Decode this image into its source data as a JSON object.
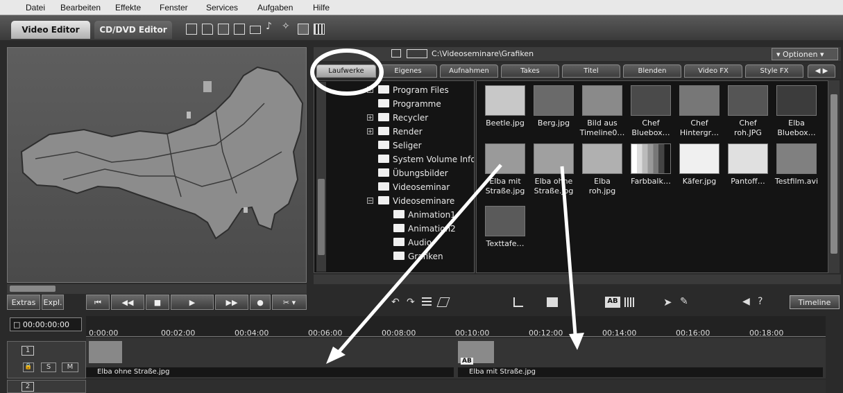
{
  "menu": [
    "Datei",
    "Bearbeiten",
    "Effekte",
    "Fenster",
    "Services",
    "Aufgaben",
    "Hilfe"
  ],
  "main_tabs": {
    "video": "Video Editor",
    "cd": "CD/DVD Editor"
  },
  "browser": {
    "path": "C:\\Videoseminare\\Grafiken",
    "options": "Optionen"
  },
  "sub_tabs": [
    "Laufwerke",
    "Eigenes",
    "Aufnahmen",
    "Takes",
    "Titel",
    "Blenden",
    "Video FX",
    "Style FX"
  ],
  "tree": [
    "Program Files",
    "Programme",
    "Recycler",
    "Render",
    "Seliger",
    "System Volume Infor",
    "Übungsbilder",
    "Videoseminar",
    "Videoseminare",
    "Animation1",
    "Animation2",
    "Audio",
    "Grafiken"
  ],
  "files": [
    {
      "name1": "Beetle.jpg",
      "name2": "",
      "color": "#c8c8c8"
    },
    {
      "name1": "Berg.jpg",
      "name2": "",
      "color": "#6a6a6a"
    },
    {
      "name1": "Bild aus",
      "name2": "Timeline0…",
      "color": "#8a8a8a"
    },
    {
      "name1": "Chef",
      "name2": "Bluebox…",
      "color": "#4a4a4a"
    },
    {
      "name1": "Chef",
      "name2": "Hintergr…",
      "color": "#777777"
    },
    {
      "name1": "Chef",
      "name2": "roh.JPG",
      "color": "#555555"
    },
    {
      "name1": "Elba",
      "name2": "Bluebox…",
      "color": "#3c3c3c"
    },
    {
      "name1": "Elba mit",
      "name2": "Straße.jpg",
      "color": "#9a9a9a"
    },
    {
      "name1": "Elba ohne",
      "name2": "Straße.jpg",
      "color": "#a0a0a0"
    },
    {
      "name1": "Elba",
      "name2": "roh.jpg",
      "color": "#b0b0b0"
    },
    {
      "name1": "Farbbalk…",
      "name2": "",
      "color": "#dddddd"
    },
    {
      "name1": "Käfer.jpg",
      "name2": "",
      "color": "#f0f0f0"
    },
    {
      "name1": "Pantoff…",
      "name2": "",
      "color": "#e0e0e0"
    },
    {
      "name1": "Testfilm.avi",
      "name2": "",
      "color": "#808080"
    },
    {
      "name1": "Texttafe…",
      "name2": "",
      "color": "#5a5a5a"
    }
  ],
  "transport": {
    "extras": "Extras",
    "expl": "Expl."
  },
  "timeline": {
    "button": "Timeline",
    "timecode": "00:00:00:00",
    "ticks": [
      "0:00:00",
      "00:02:00",
      "00:04:00",
      "00:06:00",
      "00:08:00",
      "00:10:00",
      "00:12:00",
      "00:14:00",
      "00:16:00",
      "00:18:00"
    ],
    "track1": {
      "number": "1",
      "s": "S",
      "m": "M"
    },
    "track2": {
      "number": "2"
    },
    "clip1": "Elba ohne Straße.jpg",
    "clip2": "Elba mit Straße.jpg",
    "ab": "AB"
  }
}
